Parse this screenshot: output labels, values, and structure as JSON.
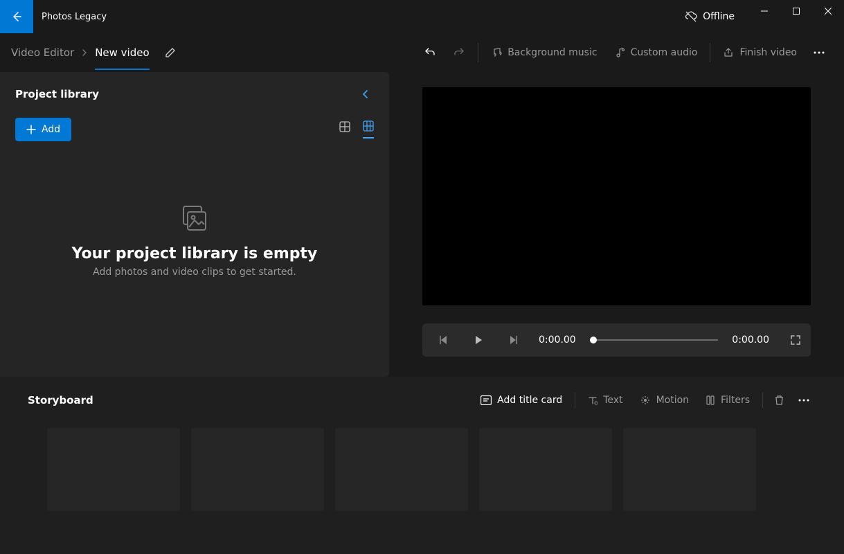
{
  "titlebar": {
    "app_name": "Photos Legacy",
    "offline_label": "Offline"
  },
  "breadcrumb": {
    "root": "Video Editor",
    "current": "New video"
  },
  "toolbar": {
    "background_music": "Background music",
    "custom_audio": "Custom audio",
    "finish_video": "Finish video"
  },
  "library": {
    "title": "Project library",
    "add_label": "Add",
    "empty_title": "Your project library is empty",
    "empty_subtitle": "Add photos and video clips to get started."
  },
  "playback": {
    "current_time": "0:00.00",
    "total_time": "0:00.00"
  },
  "storyboard": {
    "title": "Storyboard",
    "add_title_card": "Add title card",
    "text": "Text",
    "motion": "Motion",
    "filters": "Filters"
  }
}
